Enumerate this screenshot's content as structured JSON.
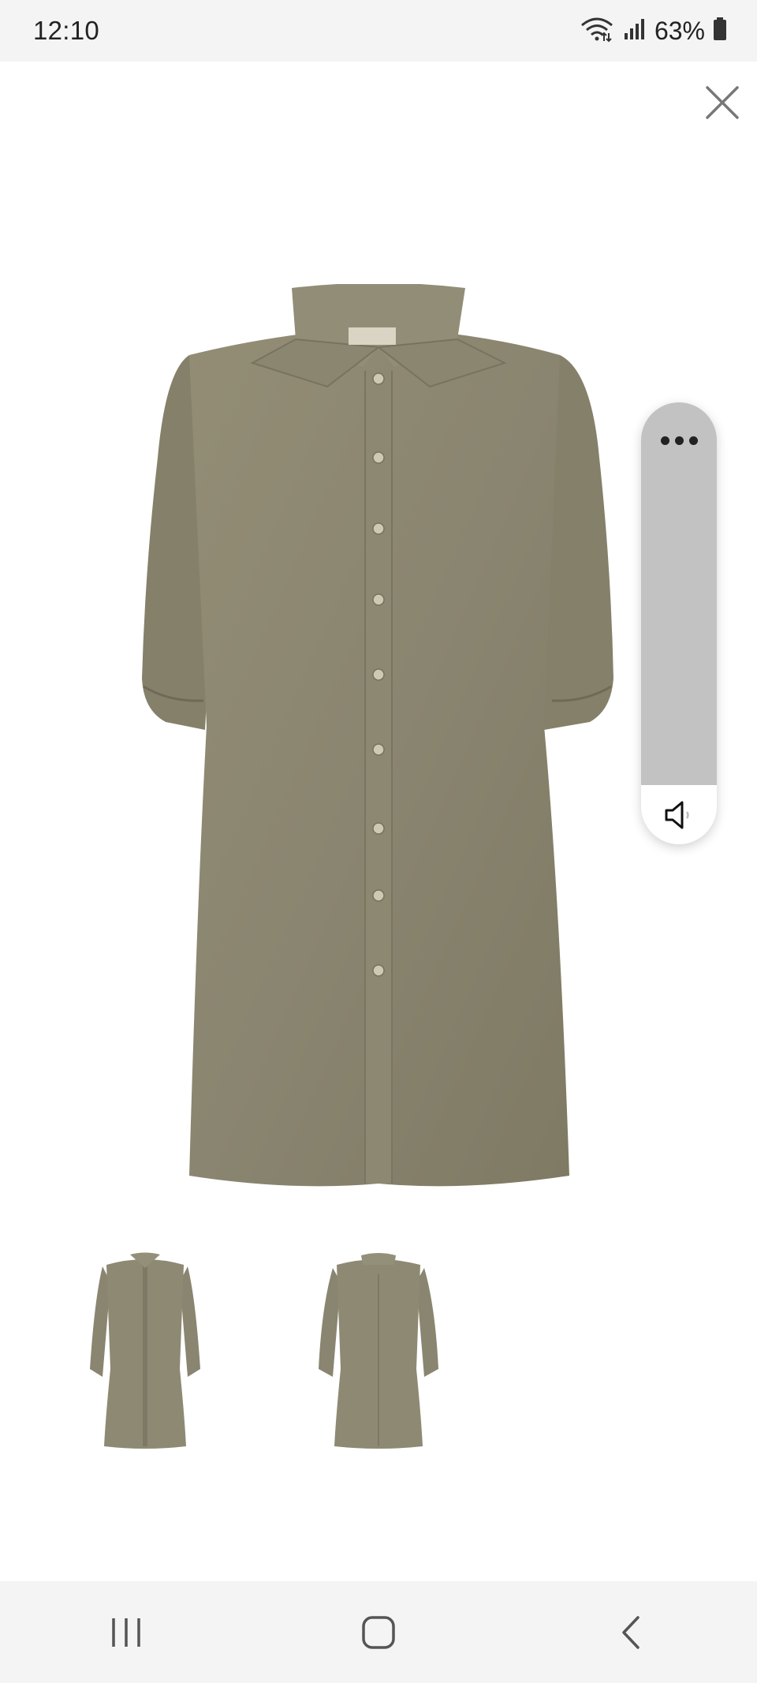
{
  "status_bar": {
    "time": "12:10",
    "battery_percent": "63%",
    "icons": [
      "wifi-icon",
      "signal-icon",
      "battery-icon"
    ]
  },
  "viewer": {
    "close_icon": "close-icon",
    "main_image": "dress-front-large",
    "thumbnails": [
      {
        "name": "dress-front-thumbnail",
        "selected": true
      },
      {
        "name": "dress-back-thumbnail",
        "selected": false
      }
    ]
  },
  "volume_panel": {
    "more_icon": "more-options-icon",
    "speaker_icon": "speaker-icon",
    "level": 0.0
  },
  "navigation_bar": {
    "icons": [
      "recent-apps-icon",
      "home-icon",
      "back-icon"
    ]
  },
  "colors": {
    "fabric": "#8b866f",
    "status_background": "#f4f4f4",
    "volume_track": "#c2c2c2"
  }
}
